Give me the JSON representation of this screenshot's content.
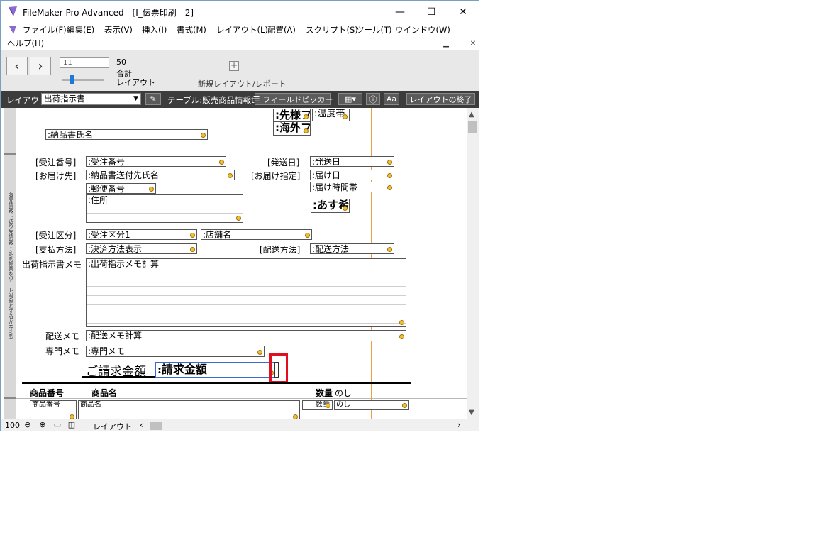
{
  "window": {
    "title": "FileMaker Pro Advanced - [I_伝票印刷 - 2]",
    "minimize": "—",
    "maximize": "☐",
    "close": "✕"
  },
  "menu": [
    "ファイル(F)",
    "編集(E)",
    "表示(V)",
    "挿入(I)",
    "書式(M)",
    "レイアウト(L)",
    "配置(A)",
    "スクリプト(S)",
    "ツール(T)",
    "ウインドウ(W)"
  ],
  "menu2": {
    "help": "ヘルプ(H)"
  },
  "toolbar": {
    "record_value": "11",
    "total": "50",
    "total_label": "合計",
    "layout_label": "レイアウト",
    "new_layout": "新規レイアウト/レポート",
    "back_icon": "chevron-left-icon",
    "forward_icon": "chevron-right-icon"
  },
  "layoutbar": {
    "layout_prefix": "レイアウト:",
    "layout_name": "出荷指示書",
    "table_label": "テーブル:販売商品情報t",
    "field_picker": "フィールドピッカー",
    "exit_layout": "レイアウトの終了"
  },
  "part_label": "販売情報：送り先情報・印刷帳票をソート対象とするか(印刷)",
  "labels": {
    "order_no": "[受注番号]",
    "ship_to": "[お届け先]",
    "ship_date": "[発送日]",
    "delivery_spec": "[お届け指定]",
    "order_type": "[受注区分]",
    "payment": "[支払方法]",
    "ship_method": "[配送方法]",
    "memo": "出荷指示書メモ",
    "delivery_memo": "配送メモ",
    "special_memo": "専門メモ",
    "billing": "ご請求金額",
    "col_product_no": "商品番号",
    "col_product_name": "商品名",
    "col_qty": "数量",
    "col_noshi": "のし"
  },
  "fields": {
    "destination": ":先様フ",
    "temperature": ":温度帯",
    "overseas": ":海外フ",
    "recipient_name": ":納品書氏名",
    "order_no": ":受注番号",
    "ship_to_name": ":納品書送付先氏名",
    "zip": ":郵便番号",
    "address": ":住所",
    "ship_date": ":発送日",
    "delivery_date": ":届け日",
    "delivery_time": ":届け時間帯",
    "tomorrow": ":あす希",
    "order_type": ":受注区分1",
    "shop": ":店舗名",
    "payment": ":決済方法表示",
    "ship_method": ":配送方法",
    "memo": ":出荷指示メモ計算",
    "delivery_memo": ":配送メモ計算",
    "special_memo": ":専門メモ",
    "billing": ":請求金額",
    "row_product_no": "商品番号",
    "row_product_name": "商品名",
    "row_qty": "数量",
    "row_noshi": "のし"
  },
  "statusbar": {
    "zoom": "100",
    "mode": "レイアウト"
  }
}
